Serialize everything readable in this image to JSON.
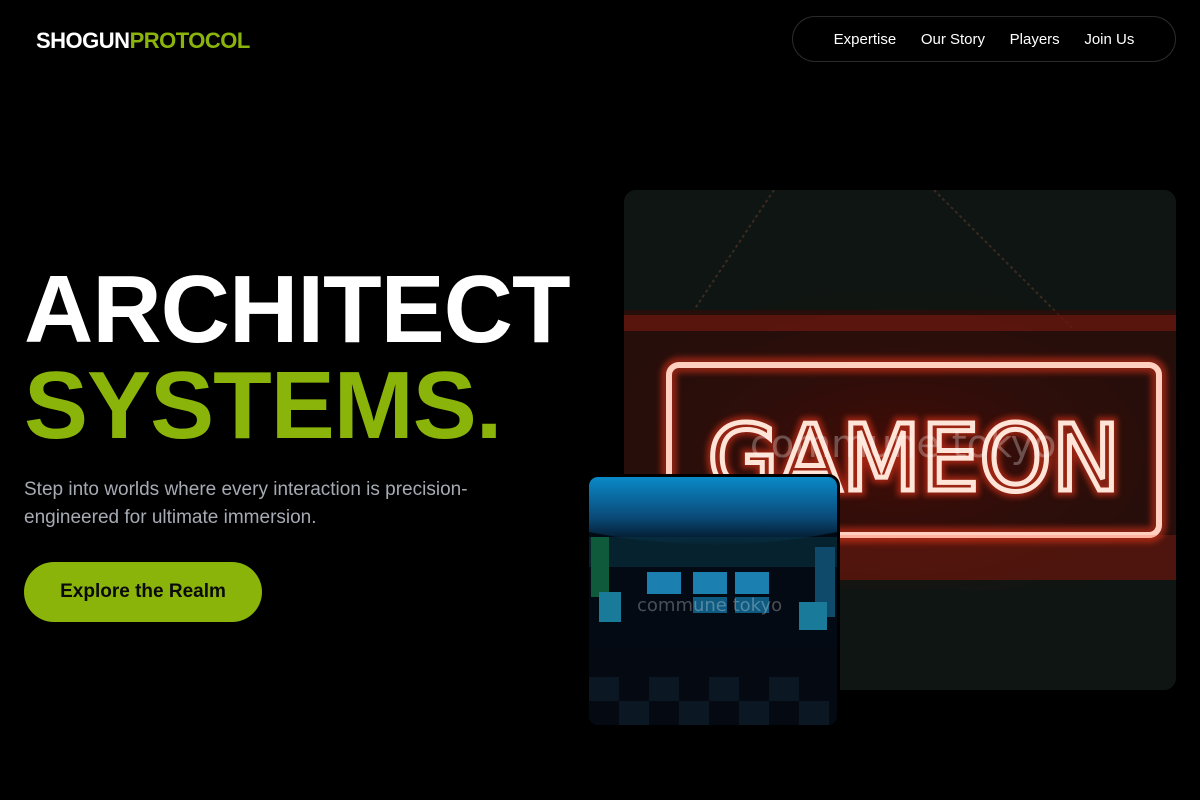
{
  "brand": {
    "part1": "SHOGUN",
    "part2": "PROTOCOL"
  },
  "nav": {
    "items": [
      "Expertise",
      "Our Story",
      "Players",
      "Join Us"
    ]
  },
  "hero": {
    "line1": "ARCHITECT",
    "line2": "SYSTEMS.",
    "subtitle": "Step into worlds where every interaction is precision-engineered for ultimate immersion.",
    "cta": "Explore the Realm"
  },
  "images": {
    "main": {
      "sign_text": "GAMEON",
      "watermark": "commune tokyo",
      "subject": "neon GAME ON sign"
    },
    "secondary": {
      "watermark": "commune tokyo",
      "subject": "arcade room with blue lighting"
    }
  },
  "colors": {
    "accent": "#8ab40a",
    "background": "#000000",
    "muted_text": "#a6aab3",
    "neon": "#ff5a3a"
  },
  "icons": []
}
